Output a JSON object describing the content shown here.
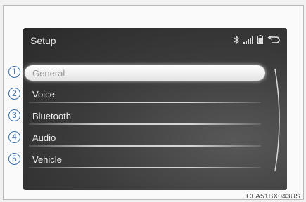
{
  "screen": {
    "title": "Setup",
    "status_icons": [
      "bluetooth-icon",
      "signal-icon",
      "battery-icon",
      "back-icon"
    ]
  },
  "menu": [
    {
      "number": "1",
      "label": "General",
      "selected": true
    },
    {
      "number": "2",
      "label": "Voice",
      "selected": false
    },
    {
      "number": "3",
      "label": "Bluetooth",
      "selected": false
    },
    {
      "number": "4",
      "label": "Audio",
      "selected": false
    },
    {
      "number": "5",
      "label": "Vehicle",
      "selected": false
    }
  ],
  "figure_code": "CLA51BX043US",
  "colors": {
    "callout": "#3b6fa8",
    "screen_bg": "#3a3a3a",
    "selected_bar": "#ffffff"
  }
}
